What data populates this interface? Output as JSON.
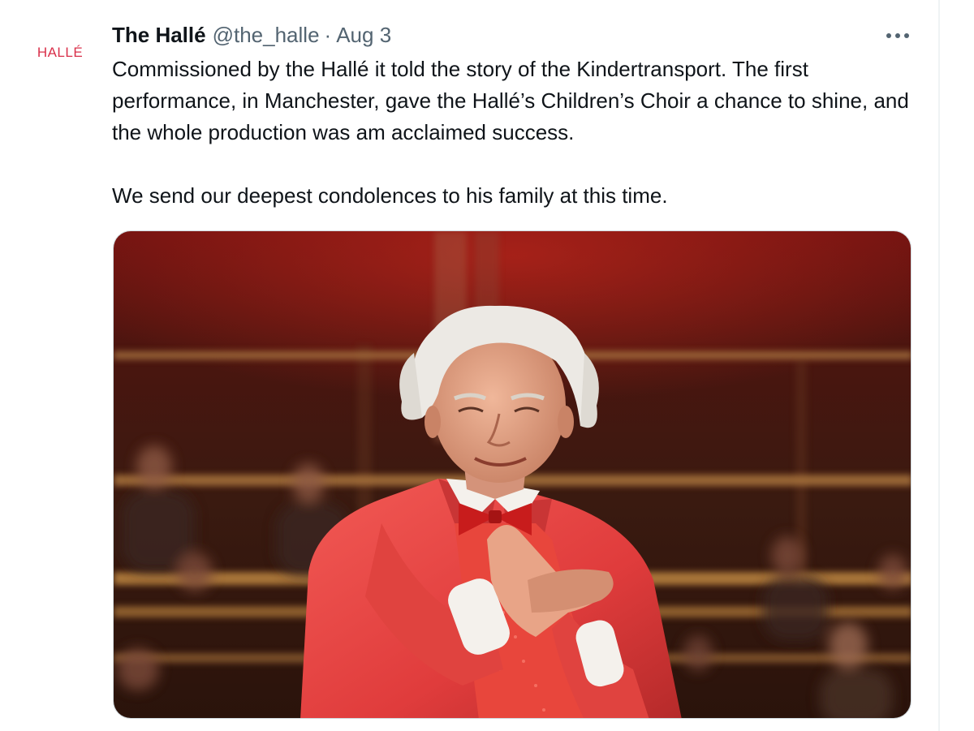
{
  "tweet": {
    "avatar_text": "HALLÉ",
    "display_name": "The Hallé",
    "handle": "@the_halle",
    "separator": "·",
    "timestamp": "Aug 3",
    "more_icon": "ellipsis-icon",
    "paragraphs": [
      "Commissioned by the Hallé it told the story of the Kindertransport. The first performance, in Manchester, gave the Hallé’s Children’s Choir a chance to shine, and the whole production was am acclaimed success.",
      "We send our deepest condolences to his family at this time."
    ]
  },
  "colors": {
    "brand_red": "#d9304a",
    "secondary_text": "#536471",
    "primary_text": "#0f1419"
  }
}
